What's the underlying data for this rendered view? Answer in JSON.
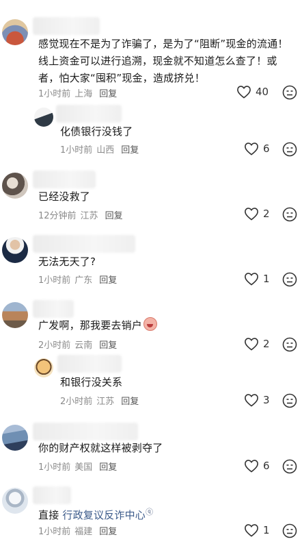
{
  "comments": [
    {
      "text": "感觉现在不是为了诈骗了，是为了“阻断”现金的流通！线上资金可以进行追溯，现金就不知道怎么查了！或者，怕大家“囤积”现金，造成挤兑！",
      "time": "1小时前",
      "location": "上海",
      "reply": "回复",
      "likes": "40",
      "avatar_colors": [
        "#7c8fb5",
        "#c9573d",
        "#e0c7a0"
      ]
    },
    {
      "text": "化债银行没钱了",
      "time": "1小时前",
      "location": "山西",
      "reply": "回复",
      "likes": "6",
      "avatar_colors": [
        "#e8e8e8",
        "#2f3a45"
      ]
    },
    {
      "text": "已经没救了",
      "time": "12分钟前",
      "location": "江苏",
      "reply": "回复",
      "likes": "2",
      "avatar_colors": [
        "#cfc6bd",
        "#5e534c"
      ]
    },
    {
      "text": "无法无天了?",
      "time": "1小时前",
      "location": "广东",
      "reply": "回复",
      "likes": "1",
      "avatar_colors": [
        "#f1f1f1",
        "#1b2a44"
      ]
    },
    {
      "text": "广发啊，那我要去销户",
      "time": "2小时前",
      "location": "云南",
      "reply": "回复",
      "likes": "2",
      "avatar_colors": [
        "#b9845a",
        "#6c8fb1"
      ]
    },
    {
      "text": "和银行没关系",
      "time": "2小时前",
      "location": "江苏",
      "reply": "回复",
      "likes": "3",
      "avatar_colors": [
        "#f2c37a",
        "#6b4a2a"
      ]
    },
    {
      "text": "你的财产权就这样被剥夺了",
      "time": "1小时前",
      "location": "美国",
      "reply": "回复",
      "likes": "6",
      "avatar_colors": [
        "#6f8fb3",
        "#2e3f5c"
      ]
    },
    {
      "text_plain": "直接",
      "text_link": "行政复议反诈中心",
      "time": "1小时前",
      "location": "福建",
      "reply": "回复",
      "likes": "1",
      "avatar_colors": [
        "#dfe6ee",
        "#a9b6c6"
      ]
    }
  ],
  "link_color": "#3b5a8a"
}
